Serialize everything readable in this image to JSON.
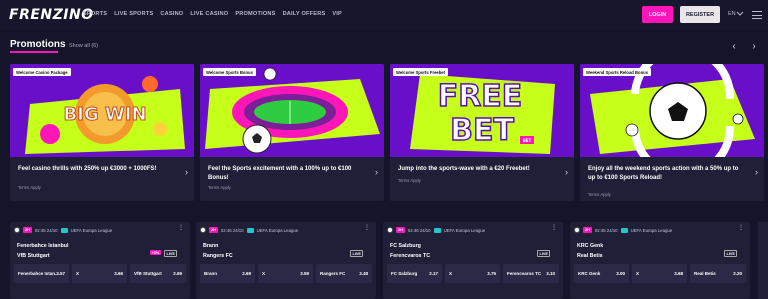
{
  "header": {
    "logo": "FRENZINO",
    "nav": [
      "SPORTS",
      "LIVE SPORTS",
      "CASINO",
      "LIVE CASINO",
      "PROMOTIONS",
      "DAILY OFFERS",
      "VIP"
    ],
    "login": "LOGIN",
    "register": "REGISTER",
    "language": "EN"
  },
  "promotions": {
    "title": "Promotions",
    "show_all": "Show all (6)",
    "cards": [
      {
        "tag": "Welcome Casino Package",
        "text": "Feel casino thrills with 250% up €3000 + 1000FS!",
        "terms": "Terms Apply",
        "art": "BIG WIN"
      },
      {
        "tag": "Welcome Sports Bonus",
        "text": "Feel the Sports excitement with a 100% up to €100 Bonus!",
        "terms": "Terms Apply",
        "art": "stadium"
      },
      {
        "tag": "Welcome Sports Freebet",
        "text": "Jump into the sports-wave with a €20 Freebet!",
        "terms": "Terms Apply",
        "art_line1": "FREE",
        "art_line2": "BET",
        "art_small": "BET"
      },
      {
        "tag": "Weekend Sports Reload Bonus",
        "text": "Enjoy all the weekend sports action with a 50% up to up to €100 Sports Reload!",
        "terms": "Terms Apply",
        "art": "reload"
      }
    ]
  },
  "matches": [
    {
      "badge": "2H",
      "time": "02:45 24/10",
      "league": "UEFA Europa League",
      "home": "Fenerbahce Istanbul",
      "away": "VfB Stuttgart",
      "boost": "+3%",
      "live": "LIVE",
      "dots": "⋮",
      "odds": [
        {
          "label": "Fenerbahce Istan...",
          "value": "3.57"
        },
        {
          "label": "X",
          "value": "3.66"
        },
        {
          "label": "VfB Stuttgart",
          "value": "2.69"
        }
      ]
    },
    {
      "badge": "2H",
      "time": "02:45 24/10",
      "league": "UEFA Europa League",
      "home": "Brann",
      "away": "Rangers FC",
      "live": "LIVE",
      "dots": "⋮",
      "odds": [
        {
          "label": "Brann",
          "value": "2.69"
        },
        {
          "label": "X",
          "value": "3.59"
        },
        {
          "label": "Rangers FC",
          "value": "3.48"
        }
      ]
    },
    {
      "badge": "2H",
      "time": "02:45 24/10",
      "league": "UEFA Europa League",
      "home": "FC Salzburg",
      "away": "Ferencvaros TC",
      "live": "LIVE",
      "dots": "⋮",
      "odds": [
        {
          "label": "FC Salzburg",
          "value": "2.17"
        },
        {
          "label": "X",
          "value": "3.75"
        },
        {
          "label": "Ferencvaros TC",
          "value": "3.10"
        }
      ]
    },
    {
      "badge": "2H",
      "time": "02:45 24/10",
      "league": "UEFA Europa League",
      "home": "KRC Genk",
      "away": "Real Betis",
      "live": "LIVE",
      "dots": "⋮",
      "odds": [
        {
          "label": "KRC Genk",
          "value": "3.00"
        },
        {
          "label": "X",
          "value": "3.68"
        },
        {
          "label": "Real Betis",
          "value": "2.20"
        }
      ]
    }
  ],
  "colors": {
    "accent": "#ff16b9",
    "background": "#14142a",
    "card": "#1f1f38",
    "promo_purple": "#6a0fc9",
    "promo_lime": "#c6ff1a"
  },
  "icons": [
    "chevron-left-icon",
    "chevron-right-icon",
    "chevron-down-icon",
    "menu-icon",
    "soccer-ball-icon",
    "flag-icon"
  ]
}
